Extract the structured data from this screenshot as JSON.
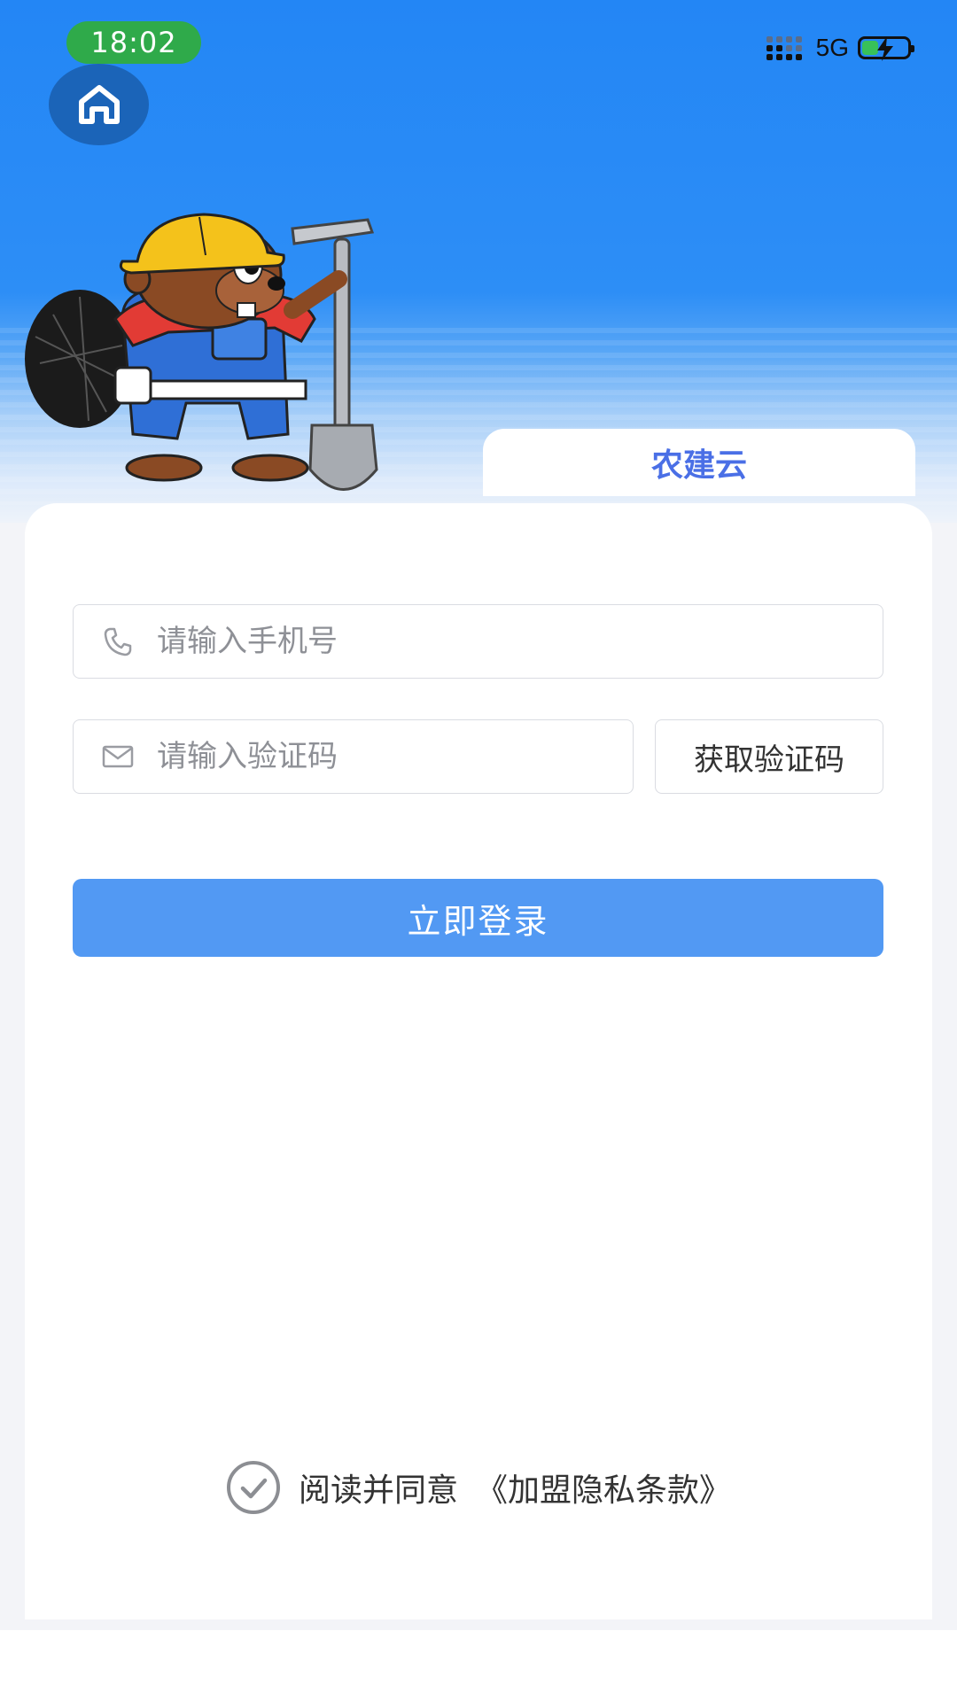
{
  "status_bar": {
    "time": "18:02",
    "network": "5G",
    "battery_level": 0.35,
    "colors": {
      "time_pill": "#2faa4a"
    }
  },
  "header": {
    "home_icon": "home-icon",
    "mascot": "beaver-construction-worker-illustration",
    "tab_label": "农建云",
    "colors": {
      "background": "#2386f5",
      "tab_text": "#4a6fe6"
    }
  },
  "form": {
    "phone": {
      "placeholder": "请输入手机号",
      "value": "",
      "icon": "phone-icon"
    },
    "code": {
      "placeholder": "请输入验证码",
      "value": "",
      "icon": "mail-icon"
    },
    "get_code_label": "获取验证码",
    "login_label": "立即登录",
    "colors": {
      "login_button": "#5299f3"
    }
  },
  "agreement": {
    "checked": true,
    "text": "阅读并同意",
    "link_text": "《加盟隐私条款》"
  }
}
